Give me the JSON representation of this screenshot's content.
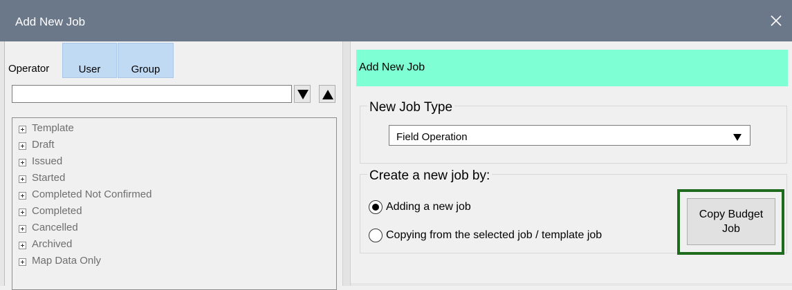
{
  "window": {
    "title": "Add New Job"
  },
  "left": {
    "tab_operator": "Operator",
    "tab_user": "User",
    "tab_group": "Group",
    "filter_value": "",
    "tree": [
      "Template",
      "Draft",
      "Issued",
      "Started",
      "Completed Not Confirmed",
      "Completed",
      "Cancelled",
      "Archived",
      "Map Data Only"
    ]
  },
  "right": {
    "header": "Add New Job",
    "job_type": {
      "title": "New Job Type",
      "selected": "Field Operation"
    },
    "create": {
      "title": "Create a new job by:",
      "options": [
        "Adding a new job",
        "Copying from the selected job / template job"
      ],
      "selected_index": 0,
      "button_line1": "Copy Budget",
      "button_line2": "Job"
    }
  },
  "colors": {
    "titlebar": "#6b7889",
    "header_band": "#7fffd4",
    "tab_bg": "#c1daf3",
    "highlight_border": "#1e6b1e"
  },
  "icons": [
    "close-icon",
    "arrow-down-icon",
    "arrow-up-icon",
    "tree-expand-icon",
    "dropdown-arrow-icon",
    "radio-icon"
  ]
}
